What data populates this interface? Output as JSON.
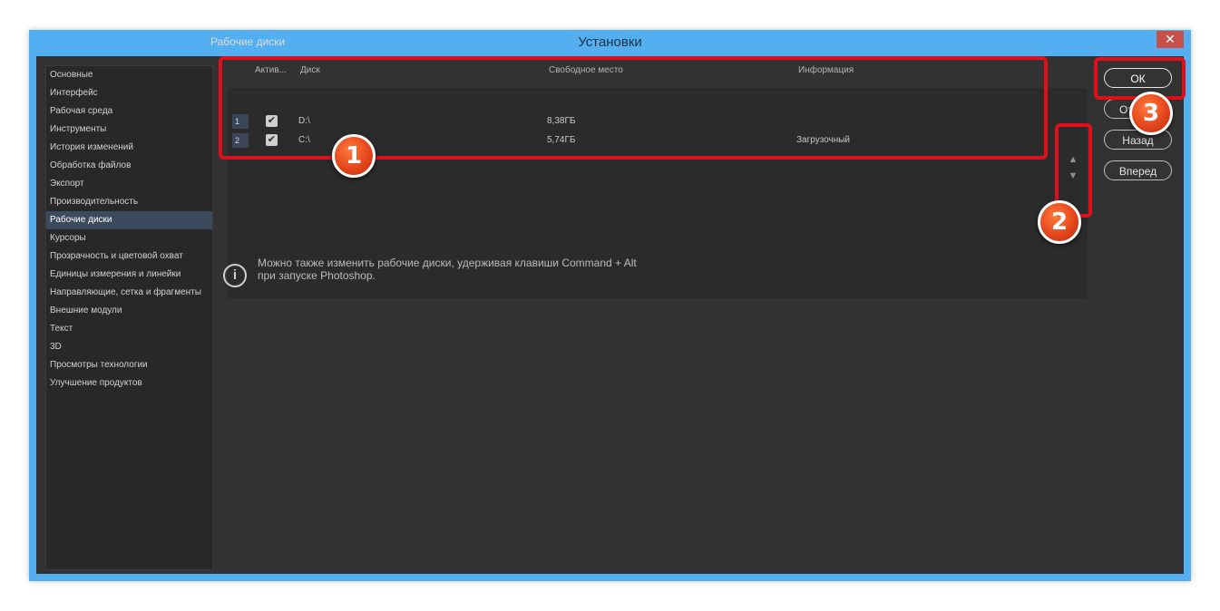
{
  "window": {
    "title": "Установки",
    "close_glyph": "✕"
  },
  "sidebar": {
    "items": [
      {
        "label": "Основные"
      },
      {
        "label": "Интерфейс"
      },
      {
        "label": "Рабочая среда"
      },
      {
        "label": "Инструменты"
      },
      {
        "label": "История изменений"
      },
      {
        "label": "Обработка файлов"
      },
      {
        "label": "Экспорт"
      },
      {
        "label": "Производительность"
      },
      {
        "label": "Рабочие диски",
        "selected": true
      },
      {
        "label": "Курсоры"
      },
      {
        "label": "Прозрачность и цветовой охват"
      },
      {
        "label": "Единицы измерения и линейки"
      },
      {
        "label": "Направляющие, сетка и фрагменты"
      },
      {
        "label": "Внешние модули"
      },
      {
        "label": "Текст"
      },
      {
        "label": "3D"
      },
      {
        "label": "Просмотры технологии"
      },
      {
        "label": "Улучшение продуктов"
      }
    ]
  },
  "scratch_disks": {
    "title": "Рабочие диски",
    "columns": {
      "active": "Актив...",
      "disk": "Диск",
      "free_space": "Свободное место",
      "info": "Информация"
    },
    "rows": [
      {
        "num": "1",
        "active": true,
        "disk": "D:\\",
        "free": "8,38ГБ",
        "info": ""
      },
      {
        "num": "2",
        "active": true,
        "disk": "C:\\",
        "free": "5,74ГБ",
        "info": "Загрузочный"
      }
    ],
    "move_up_glyph": "▲",
    "move_down_glyph": "▼"
  },
  "info": {
    "icon": "info-icon",
    "line1": "Можно также изменить рабочие диски, удерживая клавиши Command + Alt",
    "line2": "при запуске Photoshop."
  },
  "buttons": {
    "ok": "ОК",
    "cancel": "От",
    "back": "Назад",
    "forward": "Вперед"
  },
  "annotations": {
    "badge1": "1",
    "badge2": "2",
    "badge3": "3",
    "color": "#e0101a"
  }
}
